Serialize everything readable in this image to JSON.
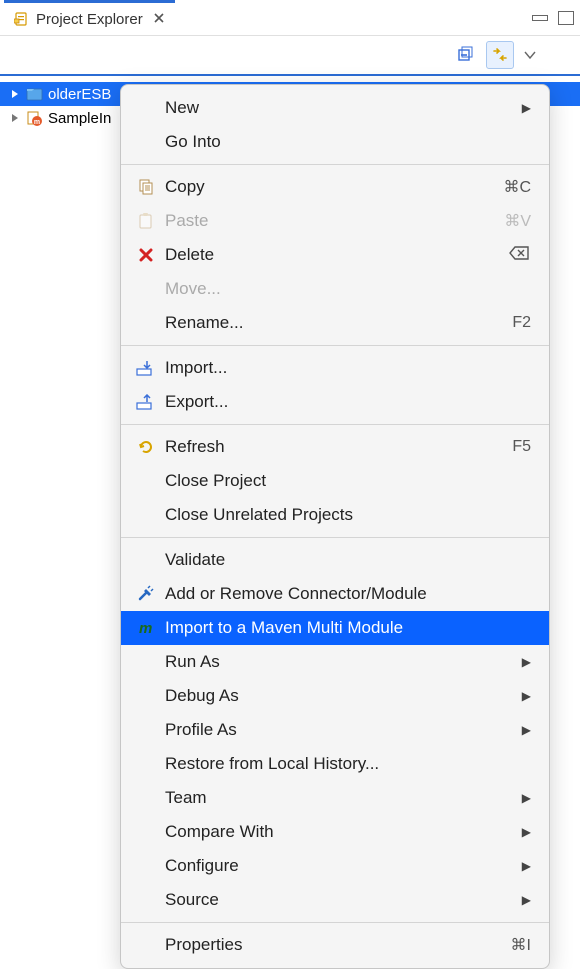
{
  "view": {
    "tab_title": "Project Explorer"
  },
  "tree": {
    "items": [
      {
        "label": "olderESB"
      },
      {
        "label": "SampleIn"
      }
    ]
  },
  "menu": {
    "new": "New",
    "go_into": "Go Into",
    "copy": "Copy",
    "copy_sc": "⌘C",
    "paste": "Paste",
    "paste_sc": "⌘V",
    "delete": "Delete",
    "move": "Move...",
    "rename": "Rename...",
    "rename_sc": "F2",
    "import": "Import...",
    "export": "Export...",
    "refresh": "Refresh",
    "refresh_sc": "F5",
    "close_project": "Close Project",
    "close_unrelated": "Close Unrelated Projects",
    "validate": "Validate",
    "add_remove_connector": "Add or Remove Connector/Module",
    "import_maven": "Import to a Maven Multi Module",
    "run_as": "Run As",
    "debug_as": "Debug As",
    "profile_as": "Profile As",
    "restore_local_history": "Restore from Local History...",
    "team": "Team",
    "compare_with": "Compare With",
    "configure": "Configure",
    "source": "Source",
    "properties": "Properties",
    "properties_sc": "⌘I"
  }
}
